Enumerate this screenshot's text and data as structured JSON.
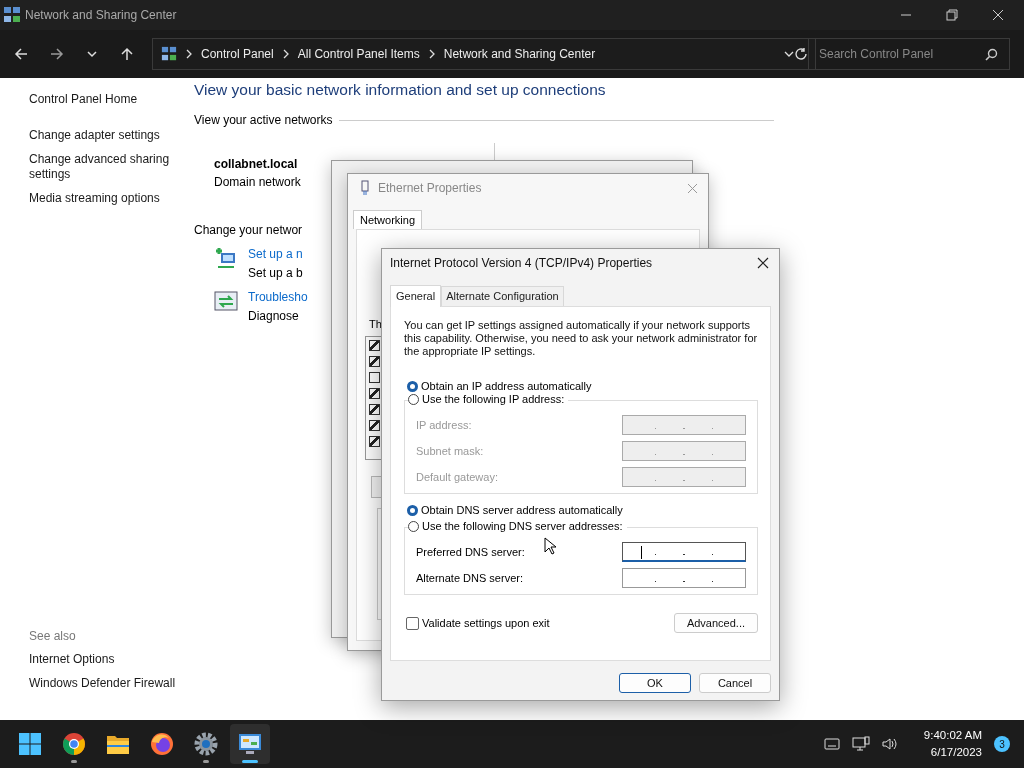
{
  "window": {
    "title": "Network and Sharing Center"
  },
  "address_bar": {
    "breadcrumbs": [
      "Control Panel",
      "All Control Panel Items",
      "Network and Sharing Center"
    ]
  },
  "search": {
    "placeholder": "Search Control Panel"
  },
  "sidebar": {
    "items": [
      "Control Panel Home",
      "Change adapter settings",
      "Change advanced sharing settings",
      "Media streaming options"
    ],
    "see_also_title": "See also",
    "see_also": [
      "Internet Options",
      "Windows Defender Firewall"
    ]
  },
  "main": {
    "heading": "View your basic network information and set up connections",
    "active_title": "View your active networks",
    "network": {
      "name": "collabnet.local",
      "type": "Domain network"
    },
    "change_title": "Change your networ",
    "tasks": [
      {
        "kind": "setup",
        "link": "Set up a n",
        "description": "Set up a b"
      },
      {
        "kind": "troubleshoot",
        "link": "Troublesho",
        "description": "Diagnose"
      }
    ]
  },
  "ethernet_properties": {
    "title": "Ethernet Properties",
    "tabs": [
      {
        "label": "Networking",
        "selected": true
      }
    ],
    "list_label": "Th",
    "components": [
      {
        "checked": true
      },
      {
        "checked": true
      },
      {
        "checked": false
      },
      {
        "checked": true
      },
      {
        "checked": true
      },
      {
        "checked": true
      },
      {
        "checked": true
      }
    ]
  },
  "ipv4": {
    "title": "Internet Protocol Version 4 (TCP/IPv4) Properties",
    "tabs": [
      {
        "label": "General",
        "selected": true
      },
      {
        "label": "Alternate Configuration",
        "selected": false
      }
    ],
    "description": "You can get IP settings assigned automatically if your network supports this capability. Otherwise, you need to ask your network administrator for the appropriate IP settings.",
    "ip_options": [
      {
        "label": "Obtain an IP address automatically",
        "selected": true
      },
      {
        "label": "Use the following IP address:",
        "selected": false
      }
    ],
    "ip_fields": [
      {
        "label": "IP address:",
        "disabled": true,
        "focused": false
      },
      {
        "label": "Subnet mask:",
        "disabled": true,
        "focused": false
      },
      {
        "label": "Default gateway:",
        "disabled": true,
        "focused": false
      }
    ],
    "dns_options": [
      {
        "label": "Obtain DNS server address automatically",
        "selected": true
      },
      {
        "label": "Use the following DNS server addresses:",
        "selected": false
      }
    ],
    "dns_fields": [
      {
        "label": "Preferred DNS server:",
        "disabled": false,
        "focused": true
      },
      {
        "label": "Alternate DNS server:",
        "disabled": false,
        "focused": false
      }
    ],
    "validate": {
      "label": "Validate settings upon exit",
      "checked": false
    },
    "advanced": "Advanced...",
    "buttons": [
      {
        "label": "OK",
        "default": true
      },
      {
        "label": "Cancel",
        "default": false
      }
    ]
  },
  "taskbar": {
    "apps": [
      {
        "kind": "start",
        "running": false,
        "selected": false
      },
      {
        "kind": "chrome",
        "running": true,
        "selected": false
      },
      {
        "kind": "folder",
        "running": false,
        "selected": false
      },
      {
        "kind": "firefox",
        "running": false,
        "selected": false
      },
      {
        "kind": "settings",
        "running": true,
        "selected": false
      },
      {
        "kind": "control-panel",
        "running": true,
        "selected": true
      }
    ],
    "time": "9:40:02 AM",
    "date": "6/17/2023",
    "notification_count": "3"
  }
}
